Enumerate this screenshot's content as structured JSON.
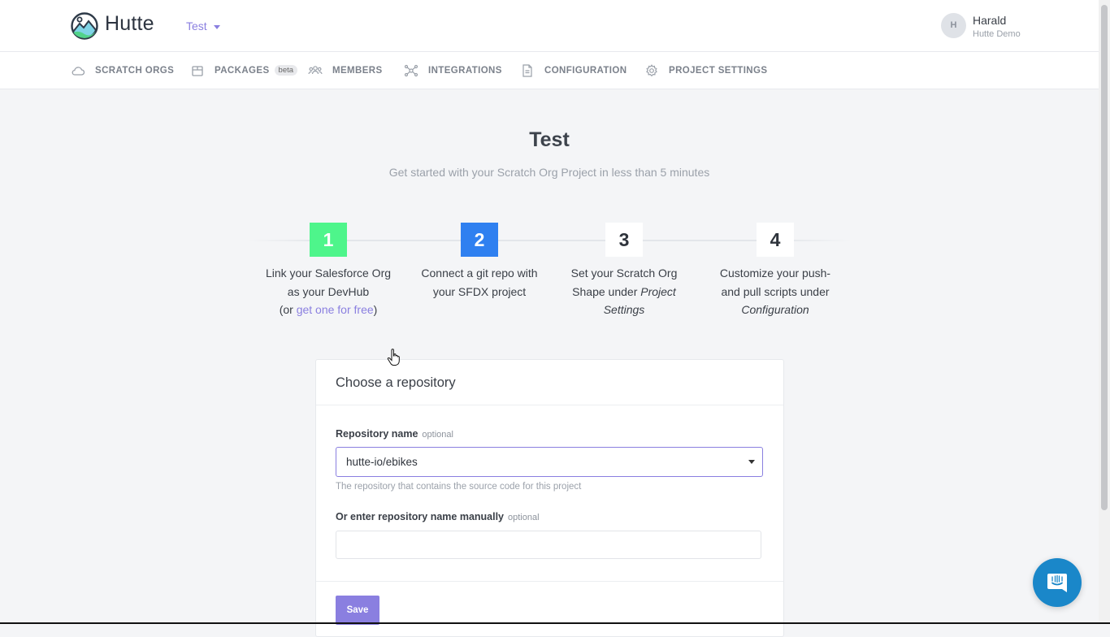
{
  "header": {
    "brand": "Hutte",
    "project_selector": "Test",
    "user": {
      "initial": "H",
      "name": "Harald",
      "org": "Hutte Demo"
    }
  },
  "nav": {
    "items": [
      {
        "label": "SCRATCH ORGS",
        "icon": "cloud-icon"
      },
      {
        "label": "PACKAGES",
        "icon": "package-icon",
        "badge": "beta"
      },
      {
        "label": "MEMBERS",
        "icon": "members-icon"
      },
      {
        "label": "INTEGRATIONS",
        "icon": "integrations-icon"
      },
      {
        "label": "CONFIGURATION",
        "icon": "document-icon"
      },
      {
        "label": "PROJECT SETTINGS",
        "icon": "gear-icon"
      }
    ]
  },
  "page": {
    "title": "Test",
    "subtitle": "Get started with your Scratch Org Project in less than 5 minutes"
  },
  "steps": [
    {
      "number": "1",
      "status": "done",
      "line1": "Link your Salesforce Org",
      "line2": "as your DevHub",
      "line3_prefix": "(or ",
      "line3_link": "get one for free",
      "line3_suffix": ")"
    },
    {
      "number": "2",
      "status": "active",
      "line1": "Connect a git repo with",
      "line2": "your SFDX project"
    },
    {
      "number": "3",
      "status": "pending",
      "line1": "Set your Scratch Org",
      "line2_prefix": "Shape under ",
      "line2_italic": "Project",
      "line3_italic": "Settings"
    },
    {
      "number": "4",
      "status": "pending",
      "line1": "Customize your push-",
      "line2": "and pull scripts under",
      "line3_italic": "Configuration"
    }
  ],
  "form": {
    "title": "Choose a repository",
    "repo_label": "Repository name",
    "repo_optional": "optional",
    "repo_value": "hutte-io/ebikes",
    "repo_help": "The repository that contains the source code for this project",
    "manual_label": "Or enter repository name manually",
    "manual_optional": "optional",
    "manual_value": "",
    "save_label": "Save"
  },
  "colors": {
    "accent": "#8a7fe0",
    "step_done": "#4ef58b",
    "step_active": "#2f80f0",
    "chat": "#1a87c9"
  }
}
